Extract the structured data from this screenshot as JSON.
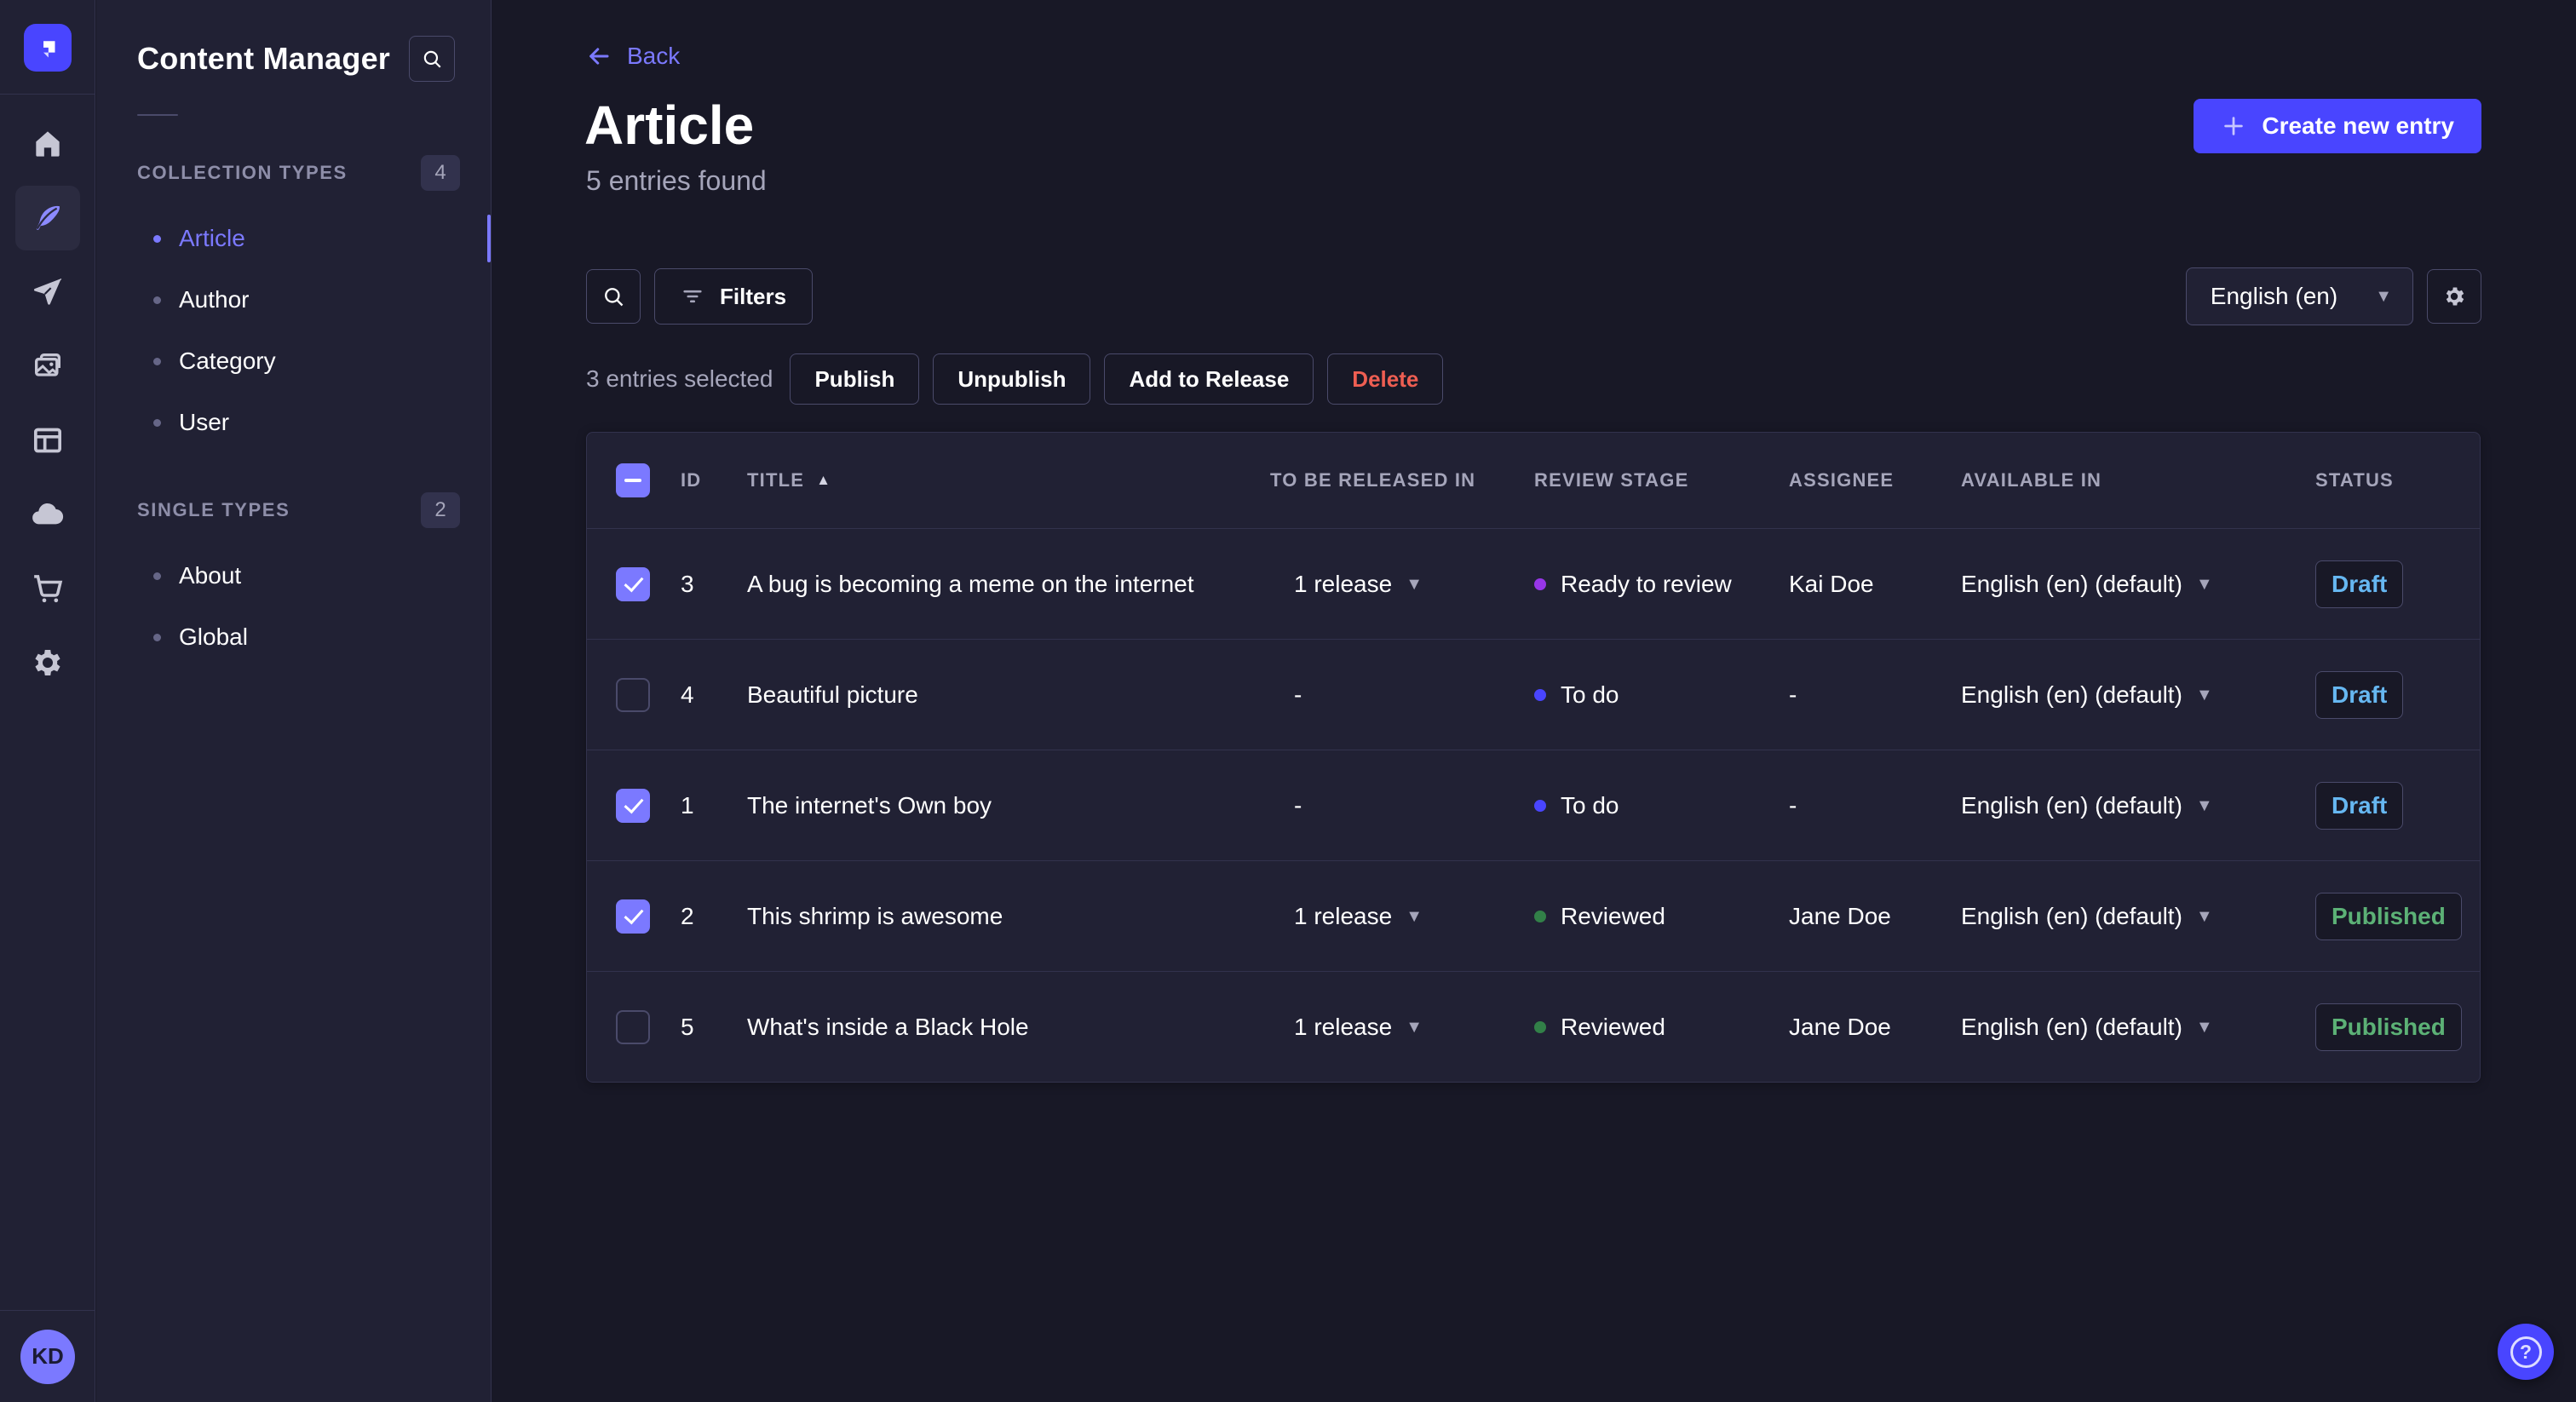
{
  "colors": {
    "accent": "#4945ff",
    "accent_light": "#7b79ff",
    "danger": "#ee5e52",
    "draft_text": "#66b7f1",
    "published_text": "#5cb176",
    "stage_todo": "#4945ff",
    "stage_ready_to_review": "#9736e8",
    "stage_reviewed": "#328048"
  },
  "rail": {
    "items": [
      {
        "icon": "home"
      },
      {
        "icon": "feather",
        "active": true
      },
      {
        "icon": "paper-plane"
      },
      {
        "icon": "images"
      },
      {
        "icon": "layout"
      },
      {
        "icon": "cloud"
      },
      {
        "icon": "cart"
      },
      {
        "icon": "gear"
      }
    ],
    "user_initials": "KD"
  },
  "subnav": {
    "title": "Content Manager",
    "sections": [
      {
        "label": "COLLECTION TYPES",
        "count": "4",
        "items": [
          {
            "label": "Article",
            "active": true
          },
          {
            "label": "Author"
          },
          {
            "label": "Category"
          },
          {
            "label": "User"
          }
        ]
      },
      {
        "label": "SINGLE TYPES",
        "count": "2",
        "items": [
          {
            "label": "About"
          },
          {
            "label": "Global"
          }
        ]
      }
    ]
  },
  "header": {
    "back_label": "Back",
    "title": "Article",
    "subtitle": "5 entries found",
    "create_label": "Create new entry"
  },
  "toolbar": {
    "filters_label": "Filters",
    "locale_value": "English (en)"
  },
  "selection": {
    "text": "3 entries selected",
    "publish": "Publish",
    "unpublish": "Unpublish",
    "add_to_release": "Add to Release",
    "delete": "Delete"
  },
  "table": {
    "header_checkbox": "indeterminate",
    "columns": [
      "ID",
      "TITLE",
      "TO BE RELEASED IN",
      "REVIEW STAGE",
      "ASSIGNEE",
      "AVAILABLE IN",
      "STATUS"
    ],
    "sorted_column": "TITLE",
    "sort_direction": "asc",
    "rows": [
      {
        "checked": true,
        "id": "3",
        "title": "A bug is becoming a meme on the internet",
        "release": "1 release",
        "release_dropdown": true,
        "stage": "Ready to review",
        "stage_color": "#9736e8",
        "assignee": "Kai Doe",
        "available": "English (en) (default)",
        "status": "Draft",
        "status_color": "#66b7f1"
      },
      {
        "checked": false,
        "id": "4",
        "title": "Beautiful picture",
        "release": "-",
        "release_dropdown": false,
        "stage": "To do",
        "stage_color": "#4945ff",
        "assignee": "-",
        "available": "English (en) (default)",
        "status": "Draft",
        "status_color": "#66b7f1"
      },
      {
        "checked": true,
        "id": "1",
        "title": "The internet's Own boy",
        "release": "-",
        "release_dropdown": false,
        "stage": "To do",
        "stage_color": "#4945ff",
        "assignee": "-",
        "available": "English (en) (default)",
        "status": "Draft",
        "status_color": "#66b7f1"
      },
      {
        "checked": true,
        "id": "2",
        "title": "This shrimp is awesome",
        "release": "1 release",
        "release_dropdown": true,
        "stage": "Reviewed",
        "stage_color": "#328048",
        "assignee": "Jane Doe",
        "available": "English (en) (default)",
        "status": "Published",
        "status_color": "#5cb176"
      },
      {
        "checked": false,
        "id": "5",
        "title": "What's inside a Black Hole",
        "release": "1 release",
        "release_dropdown": true,
        "stage": "Reviewed",
        "stage_color": "#328048",
        "assignee": "Jane Doe",
        "available": "English (en) (default)",
        "status": "Published",
        "status_color": "#5cb176"
      }
    ]
  },
  "help": {
    "label": "?"
  }
}
